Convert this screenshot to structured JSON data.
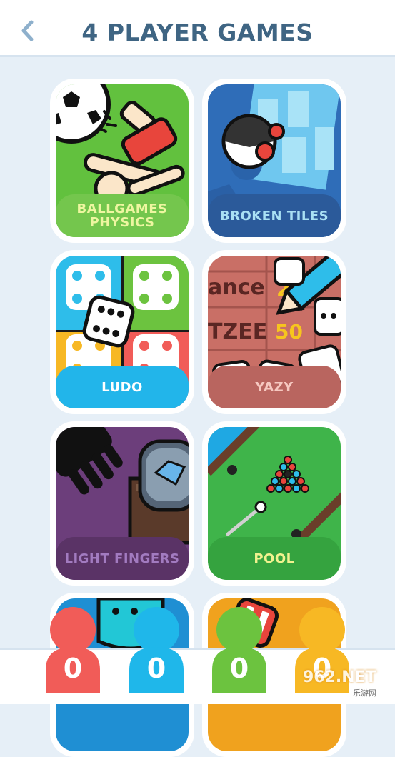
{
  "header": {
    "title": "4 PLAYER GAMES",
    "back_icon": "chevron-left-icon"
  },
  "games": [
    {
      "label": "BALLGAMES\nPHYSICS",
      "bg": "#62c13e",
      "label_bg": "#74c64d",
      "label_color": "#eef6a0"
    },
    {
      "label": "BROKEN TILES",
      "bg": "#2f6db8",
      "label_bg": "#2b5a9a",
      "label_color": "#a9e0f4"
    },
    {
      "label": "LUDO",
      "bg": "#2ebdea",
      "label_bg": "#22b5ea",
      "label_color": "#ffffff"
    },
    {
      "label": "YAZY",
      "bg": "#c96f66",
      "label_bg": "#b9655f",
      "label_color": "#f6c8c0"
    },
    {
      "label": "LIGHT FINGERS",
      "bg": "#6c3e7b",
      "label_bg": "#5a3366",
      "label_color": "#a27bc0"
    },
    {
      "label": "POOL",
      "bg": "#3fb44a",
      "label_bg": "#35a33f",
      "label_color": "#f1f28f"
    },
    {
      "label": "",
      "bg": "#1f8fd3",
      "label_bg": "#1f8fd3",
      "label_color": "#ffffff"
    },
    {
      "label": "",
      "bg": "#f0a21e",
      "label_bg": "#f0a21e",
      "label_color": "#ffffff"
    }
  ],
  "card_text": {
    "yazy_word1": "ance",
    "yazy_word2": "TZEE",
    "yazy_num1": "2",
    "yazy_num2": "50"
  },
  "players": [
    {
      "score": "0",
      "color": "#f15c58"
    },
    {
      "score": "0",
      "color": "#1fb7ea"
    },
    {
      "score": "0",
      "color": "#6cc33f"
    },
    {
      "score": "0",
      "color": "#f7b824"
    }
  ],
  "watermark": {
    "text": "962.NET",
    "sub": "乐游网"
  }
}
